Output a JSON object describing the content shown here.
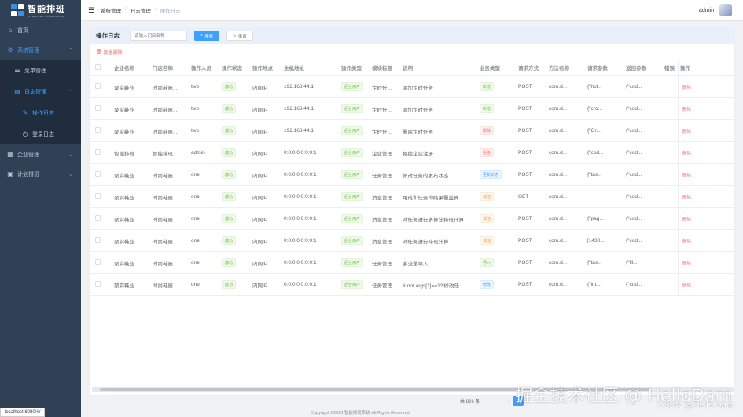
{
  "app": {
    "logo_title": "智能排班",
    "logo_sub": "INTELLIGENT SCHEDULING"
  },
  "sidebar": {
    "items": [
      {
        "label": "首页",
        "icon": "home-icon"
      },
      {
        "label": "系统管理",
        "icon": "gear-icon"
      },
      {
        "label": "菜单管理",
        "icon": "menu-icon"
      },
      {
        "label": "日志管理",
        "icon": "document-icon"
      },
      {
        "label": "操作日志",
        "icon": "edit-icon"
      },
      {
        "label": "登录日志",
        "icon": "clock-icon"
      },
      {
        "label": "企业管理",
        "icon": "building-icon"
      },
      {
        "label": "计划排班",
        "icon": "calendar-icon"
      }
    ]
  },
  "status_url": "localhost:8080/#/",
  "header": {
    "breadcrumb": [
      "系统管理",
      "日志管理",
      "操作日志"
    ],
    "user": "admin"
  },
  "toolbar": {
    "title": "操作日志",
    "search_placeholder": "请输入门店名称",
    "search_label": "搜索",
    "reset_label": "重置",
    "batch_delete_label": "批量删除"
  },
  "table": {
    "columns": [
      "企业名称",
      "门店名称",
      "操作人员",
      "操作状态",
      "操作地点",
      "主机地址",
      "操作类型",
      "模块标题",
      "说明",
      "业务类型",
      "请求方式",
      "方法名称",
      "请求参数",
      "返回参数",
      "错误",
      "操作"
    ],
    "rows": [
      {
        "company": "聚实鞋业",
        "store": "时尚鞋屋...",
        "operator": "two",
        "status": "成功",
        "location": "内网IP",
        "ip": "192.168.44.1",
        "user_type": "后台用户",
        "module": "定时任...",
        "desc": "添加定时任务",
        "biz_type": "新增",
        "biz_tag": "success",
        "method": "POST",
        "method_name": "com.d...",
        "req_params": "{\"hol...",
        "ret_params": "{\"cod...",
        "action": "删除"
      },
      {
        "company": "聚实鞋业",
        "store": "时尚鞋屋...",
        "operator": "two",
        "status": "成功",
        "location": "内网IP",
        "ip": "192.168.44.1",
        "user_type": "后台用户",
        "module": "定时任...",
        "desc": "添加定时任务",
        "biz_type": "新增",
        "biz_tag": "success",
        "method": "POST",
        "method_name": "com.d...",
        "req_params": "{\"cro...",
        "ret_params": "{\"cod...",
        "action": "删除"
      },
      {
        "company": "聚实鞋业",
        "store": "时尚鞋屋...",
        "operator": "two",
        "status": "成功",
        "location": "内网IP",
        "ip": "192.168.44.1",
        "user_type": "后台用户",
        "module": "定时任...",
        "desc": "删除定时任务",
        "biz_type": "删除",
        "biz_tag": "danger",
        "method": "POST",
        "method_name": "com.d...",
        "req_params": "{\"Gr...",
        "ret_params": "{\"cod...",
        "action": "删除"
      },
      {
        "company": "智能排班...",
        "store": "智能排班...",
        "operator": "admin",
        "status": "成功",
        "location": "内网IP",
        "ip": "0:0:0:0:0:0:0:1",
        "user_type": "后台用户",
        "module": "企业管理",
        "desc": "拒绝企业注册",
        "biz_type": "拒绝",
        "biz_tag": "danger",
        "method": "POST",
        "method_name": "com.d...",
        "req_params": "{\"cod...",
        "ret_params": "{\"cod...",
        "action": "删除"
      },
      {
        "company": "聚实鞋业",
        "store": "时尚鞋屋...",
        "operator": "one",
        "status": "成功",
        "location": "内网IP",
        "ip": "0:0:0:0:0:0:0:1",
        "user_type": "后台用户",
        "module": "任务管理",
        "desc": "修改任务的发布状态",
        "biz_type": "更新状态",
        "biz_tag": "primary",
        "method": "POST",
        "method_name": "com.d...",
        "req_params": "{\"tas...",
        "ret_params": "{\"cod...",
        "action": "删除"
      },
      {
        "company": "聚实鞋业",
        "store": "时尚鞋屋...",
        "operator": "one",
        "status": "成功",
        "location": "内网IP",
        "ip": "0:0:0:0:0:0:0:1",
        "user_type": "后台用户",
        "module": "消息管理",
        "desc": "用成和任务的结果覆盖真...",
        "biz_type": "其他",
        "biz_tag": "warning",
        "method": "GET",
        "method_name": "com.d...",
        "req_params": "",
        "ret_params": "{\"cod...",
        "action": "删除"
      },
      {
        "company": "聚实鞋业",
        "store": "时尚鞋屋...",
        "operator": "one",
        "status": "成功",
        "location": "内网IP",
        "ip": "0:0:0:0:0:0:0:1",
        "user_type": "后台用户",
        "module": "消息管理",
        "desc": "对任务进行多算法排班计算",
        "biz_type": "其他",
        "biz_tag": "warning",
        "method": "POST",
        "method_name": "com.d...",
        "req_params": "{\"pag...",
        "ret_params": "{\"cod...",
        "action": "删除"
      },
      {
        "company": "聚实鞋业",
        "store": "时尚鞋屋...",
        "operator": "one",
        "status": "成功",
        "location": "内网IP",
        "ip": "0:0:0:0:0:0:0:1",
        "user_type": "后台用户",
        "module": "消息管理",
        "desc": "对任务进行排班计算",
        "biz_type": "其他",
        "biz_tag": "warning",
        "method": "POST",
        "method_name": "com.d...",
        "req_params": "[1430...",
        "ret_params": "{\"cod...",
        "action": "删除"
      },
      {
        "company": "聚实鞋业",
        "store": "时尚鞋屋...",
        "operator": "one",
        "status": "成功",
        "location": "内网IP",
        "ip": "0:0:0:0:0:0:0:1",
        "user_type": "后台用户",
        "module": "任务管理",
        "desc": "客流量导入",
        "biz_type": "导入",
        "biz_tag": "success",
        "method": "POST",
        "method_name": "com.d...",
        "req_params": "{\"tas...",
        "ret_params": "{\"fil...",
        "action": "删除"
      },
      {
        "company": "聚实鞋业",
        "store": "时尚鞋屋...",
        "operator": "one",
        "status": "成功",
        "location": "内网IP",
        "ip": "0:0:0:0:0:0:0:1",
        "user_type": "后台用户",
        "module": "任务管理",
        "desc": "#root.args[1]==1?'修改任...",
        "biz_type": "修改",
        "biz_tag": "primary",
        "method": "POST",
        "method_name": "com.d...",
        "req_params": "{\"int...",
        "ret_params": "{\"cod...",
        "action": "删除"
      }
    ]
  },
  "pagination": {
    "total_text": "共 826 条",
    "current_page": "1"
  },
  "footer": "Copyright ©2023 智能排班系统 All Rights Reserved.",
  "watermark": {
    "line1": "掘金技术社区 @ HelloDam",
    "line2": "CSDN @Hello Dam"
  },
  "colors": {
    "sidebar_bg": "#304156",
    "accent": "#409eff",
    "danger": "#f56c6c",
    "success": "#67c23a",
    "warning": "#e6a23c"
  }
}
